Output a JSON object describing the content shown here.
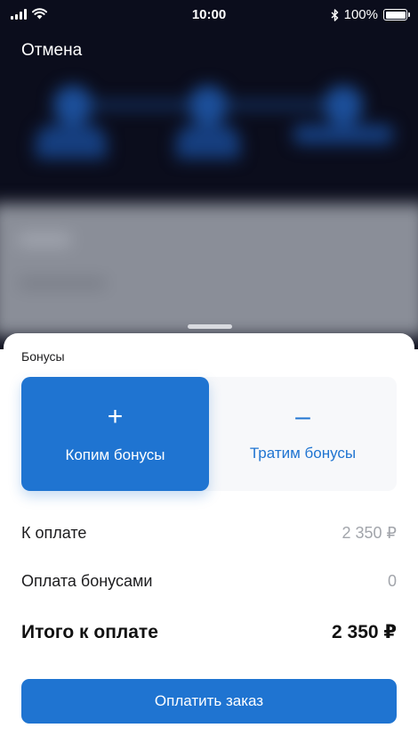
{
  "status_bar": {
    "time": "10:00",
    "battery": "100%",
    "icons": [
      "signal-icon",
      "wifi-icon",
      "bluetooth-icon",
      "battery-icon"
    ]
  },
  "header": {
    "cancel_label": "Отмена"
  },
  "sheet": {
    "title": "Бонусы",
    "options": [
      {
        "symbol": "+",
        "label": "Копим бонусы",
        "selected": true
      },
      {
        "symbol": "–",
        "label": "Тратим бонусы",
        "selected": false
      }
    ],
    "rows": [
      {
        "label": "К оплате",
        "value": "2 350 ₽"
      },
      {
        "label": "Оплата бонусами",
        "value": "0"
      }
    ],
    "total": {
      "label": "Итого к оплате",
      "value": "2 350 ₽"
    },
    "pay_button_label": "Оплатить заказ"
  },
  "colors": {
    "accent": "#1f74d1",
    "background_dark": "#0b0d1c",
    "muted_text": "#a2a5ab"
  }
}
